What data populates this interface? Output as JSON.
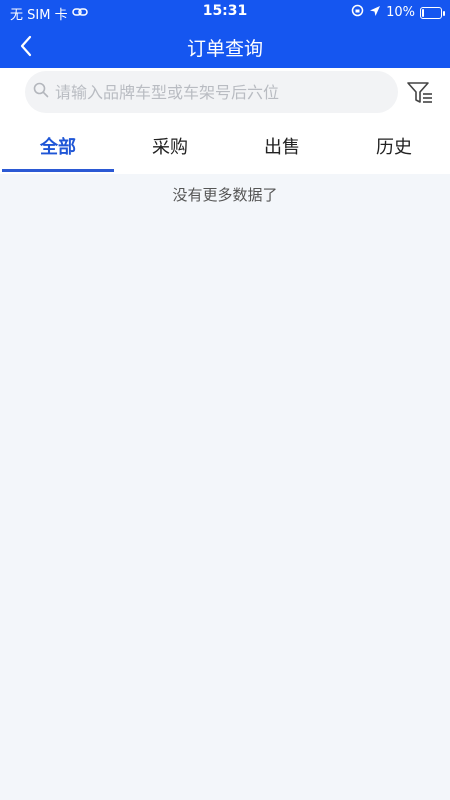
{
  "status_bar": {
    "carrier": "无 SIM 卡",
    "time": "15:31",
    "battery": "10%",
    "battery_level": 0.1
  },
  "nav": {
    "title": "订单查询",
    "back_icon": "chevron-left-icon"
  },
  "search": {
    "placeholder": "请输入品牌车型或车架号后六位",
    "value": "",
    "filter_icon": "filter-icon"
  },
  "tabs": [
    {
      "label": "全部",
      "active": true
    },
    {
      "label": "采购",
      "active": false
    },
    {
      "label": "出售",
      "active": false
    },
    {
      "label": "历史",
      "active": false
    }
  ],
  "list": {
    "empty_message": "没有更多数据了"
  },
  "colors": {
    "header_bg": "#1556f0",
    "active_tab": "#1f56d6",
    "page_bg": "#f3f6fa"
  }
}
